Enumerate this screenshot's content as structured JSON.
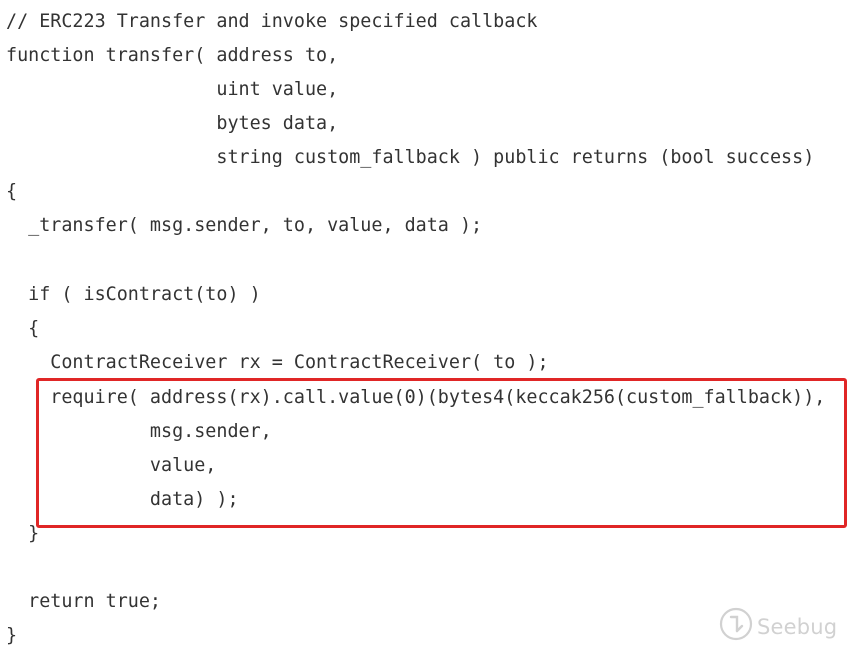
{
  "code": {
    "lines": [
      "// ERC223 Transfer and invoke specified callback",
      "function transfer( address to,",
      "                   uint value,",
      "                   bytes data,",
      "                   string custom_fallback ) public returns (bool success)",
      "{",
      "  _transfer( msg.sender, to, value, data );",
      "",
      "  if ( isContract(to) )",
      "  {",
      "    ContractReceiver rx = ContractReceiver( to );",
      "    require( address(rx).call.value(0)(bytes4(keccak256(custom_fallback)),",
      "             msg.sender,",
      "             value,",
      "             data) );",
      "  }",
      "",
      "  return true;",
      "}"
    ]
  },
  "highlight": {
    "color": "#e02626"
  },
  "watermark": {
    "text": "Seebug",
    "icon": "seebug-logo-icon"
  },
  "colors": {
    "text": "#333333",
    "background": "#ffffff"
  }
}
